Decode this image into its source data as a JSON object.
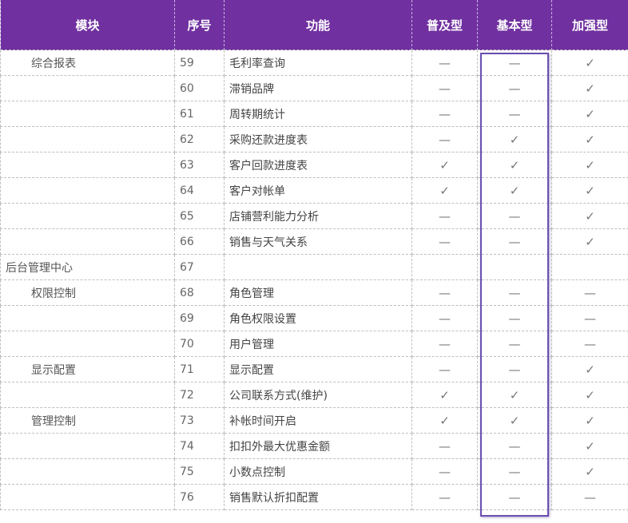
{
  "header": {
    "module": "模块",
    "number": "序号",
    "function": "功能",
    "popular": "普及型",
    "basic": "基本型",
    "enhanced": "加强型"
  },
  "marks": {
    "yes": "✓",
    "no": "—"
  },
  "rows": [
    {
      "module": "综合报表",
      "level": 1,
      "no": "59",
      "func": "毛利率查询",
      "popular": "—",
      "basic": "—",
      "enhanced": "✓"
    },
    {
      "module": "",
      "level": 1,
      "no": "60",
      "func": "滞销品牌",
      "popular": "—",
      "basic": "—",
      "enhanced": "✓"
    },
    {
      "module": "",
      "level": 1,
      "no": "61",
      "func": "周转期统计",
      "popular": "—",
      "basic": "—",
      "enhanced": "✓"
    },
    {
      "module": "",
      "level": 1,
      "no": "62",
      "func": "采购还款进度表",
      "popular": "—",
      "basic": "✓",
      "enhanced": "✓"
    },
    {
      "module": "",
      "level": 1,
      "no": "63",
      "func": "客户回款进度表",
      "popular": "✓",
      "basic": "✓",
      "enhanced": "✓"
    },
    {
      "module": "",
      "level": 1,
      "no": "64",
      "func": "客户对帐单",
      "popular": "✓",
      "basic": "✓",
      "enhanced": "✓"
    },
    {
      "module": "",
      "level": 1,
      "no": "65",
      "func": "店铺营利能力分析",
      "popular": "—",
      "basic": "—",
      "enhanced": "✓"
    },
    {
      "module": "",
      "level": 1,
      "no": "66",
      "func": "销售与天气关系",
      "popular": "—",
      "basic": "—",
      "enhanced": "✓"
    },
    {
      "module": "后台管理中心",
      "level": 0,
      "no": "67",
      "func": "",
      "popular": "",
      "basic": "",
      "enhanced": ""
    },
    {
      "module": "权限控制",
      "level": 1,
      "no": "68",
      "func": "角色管理",
      "popular": "—",
      "basic": "—",
      "enhanced": "—"
    },
    {
      "module": "",
      "level": 1,
      "no": "69",
      "func": "角色权限设置",
      "popular": "—",
      "basic": "—",
      "enhanced": "—"
    },
    {
      "module": "",
      "level": 1,
      "no": "70",
      "func": "用户管理",
      "popular": "—",
      "basic": "—",
      "enhanced": "—"
    },
    {
      "module": "显示配置",
      "level": 1,
      "no": "71",
      "func": "显示配置",
      "popular": "—",
      "basic": "—",
      "enhanced": "✓"
    },
    {
      "module": "",
      "level": 1,
      "no": "72",
      "func": "公司联系方式(维护)",
      "popular": "✓",
      "basic": "✓",
      "enhanced": "✓"
    },
    {
      "module": "管理控制",
      "level": 1,
      "no": "73",
      "func": "补帐时间开启",
      "popular": "✓",
      "basic": "✓",
      "enhanced": "✓"
    },
    {
      "module": "",
      "level": 1,
      "no": "74",
      "func": "扣扣外最大优惠金额",
      "popular": "—",
      "basic": "—",
      "enhanced": "✓"
    },
    {
      "module": "",
      "level": 1,
      "no": "75",
      "func": "小数点控制",
      "popular": "—",
      "basic": "—",
      "enhanced": "✓"
    },
    {
      "module": "",
      "level": 1,
      "no": "76",
      "func": "销售默认折扣配置",
      "popular": "—",
      "basic": "—",
      "enhanced": "—"
    }
  ]
}
